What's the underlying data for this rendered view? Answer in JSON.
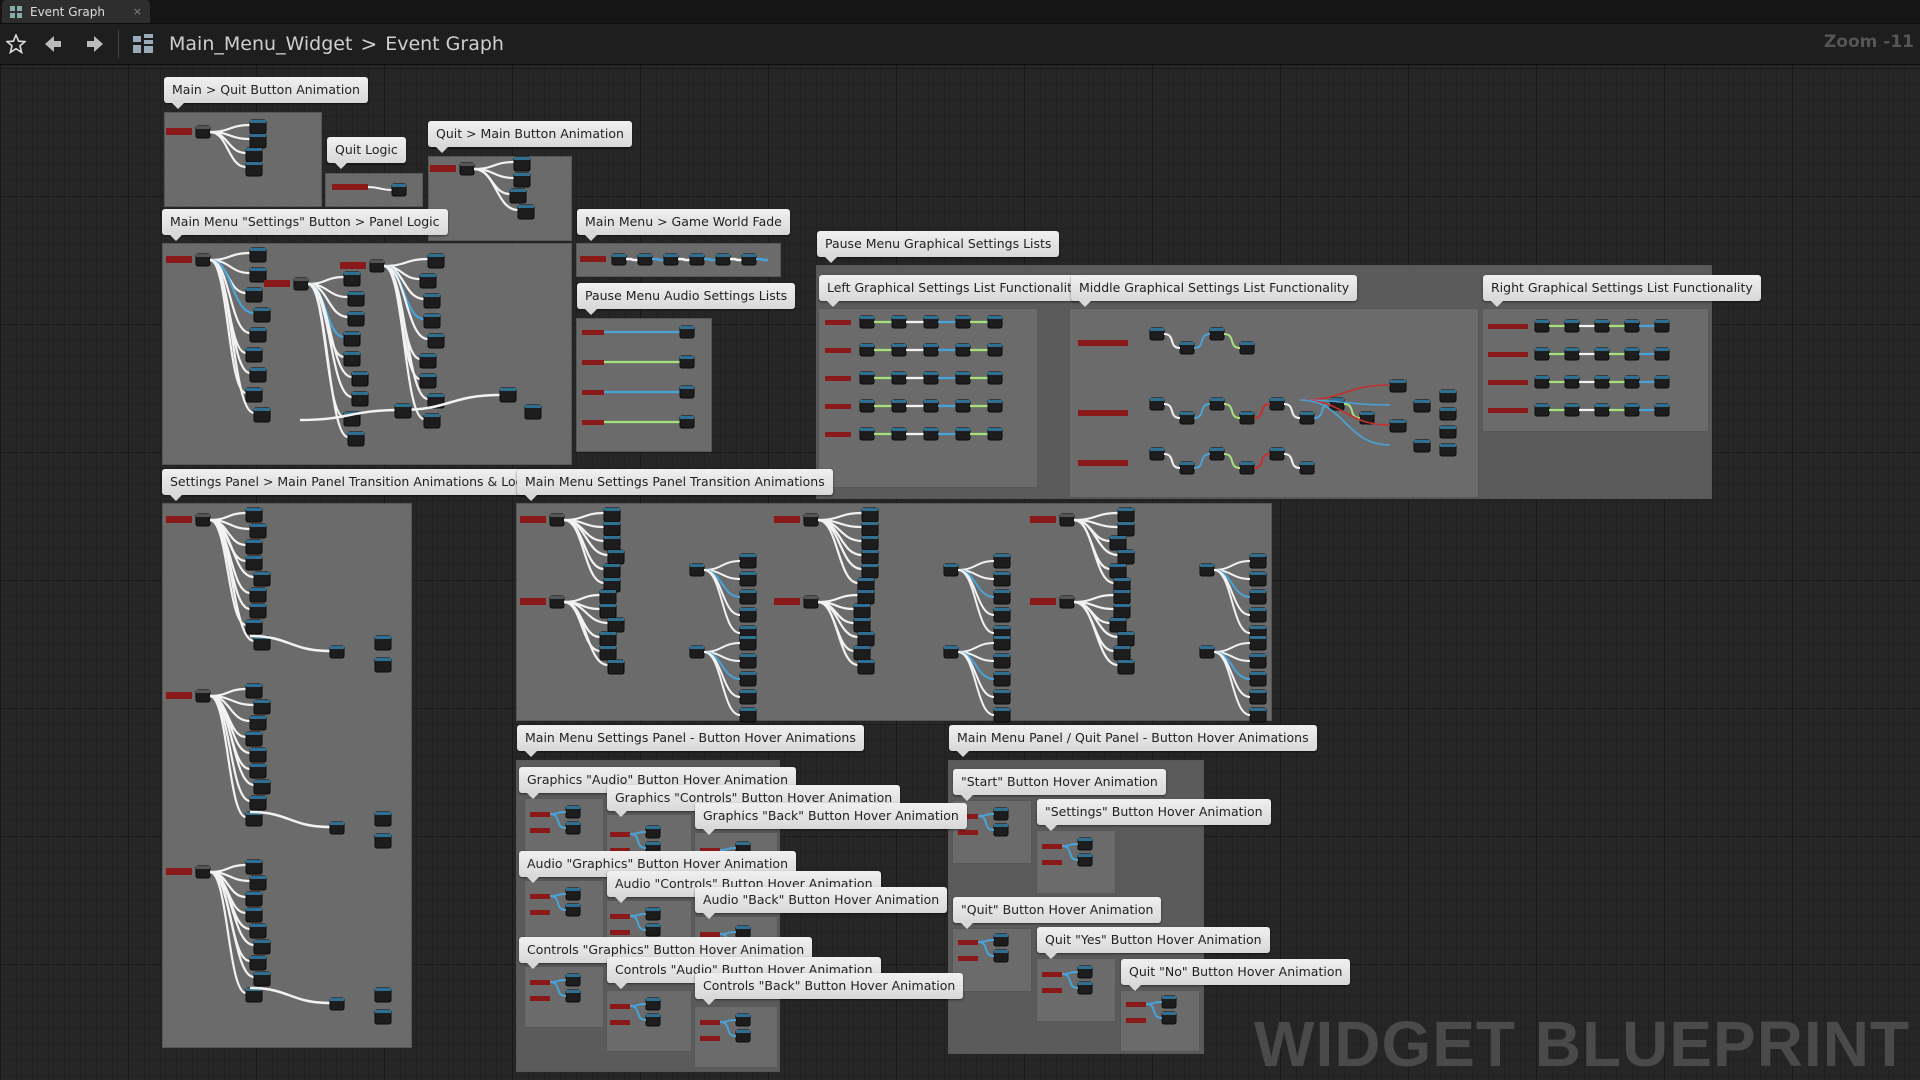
{
  "tab": {
    "title": "Event Graph",
    "close": "×"
  },
  "toolbar": {
    "star_icon": "star-icon",
    "back_icon": "back-arrow-icon",
    "forward_icon": "forward-arrow-icon"
  },
  "breadcrumb": {
    "blueprint": "Main_Menu_Widget",
    "separator": ">",
    "graph": "Event Graph"
  },
  "zoom": "Zoom -11",
  "watermark": "WIDGET BLUEPRINT",
  "comments": {
    "c1": "Main > Quit Button Animation",
    "c2": "Quit Logic",
    "c3": "Quit > Main Button Animation",
    "c4": "Main Menu \"Settings\" Button > Panel Logic",
    "c5": "Main Menu > Game World Fade",
    "c6": "Pause Menu Audio Settings Lists",
    "c7": "Pause Menu Graphical Settings Lists",
    "c8": "Left Graphical Settings List Functionality",
    "c9": "Middle Graphical Settings List Functionality",
    "c10": "Right Graphical Settings List Functionality",
    "c11": "Settings Panel > Main Panel Transition Animations & Logic",
    "c12": "Main Menu Settings Panel Transition Animations",
    "c13": "Main Menu Settings Panel - Button Hover Animations",
    "c14": "Main Menu Panel / Quit Panel - Button Hover Animations",
    "c15": "Graphics \"Audio\" Button Hover Animation",
    "c16": "Graphics \"Controls\" Button Hover Animation",
    "c17": "Graphics \"Back\" Button Hover Animation",
    "c18": "Audio \"Graphics\" Button Hover Animation",
    "c19": "Audio \"Controls\" Button Hover Animation",
    "c20": "Audio \"Back\" Button Hover Animation",
    "c21": "Controls \"Graphics\" Button Hover Animation",
    "c22": "Controls \"Audio\" Button Hover Animation",
    "c23": "Controls \"Back\" Button Hover Animation",
    "c24": "\"Start\" Button Hover Animation",
    "c25": "\"Settings\" Button Hover Animation",
    "c26": "\"Quit\" Button Hover Animation",
    "c27": "Quit \"Yes\" Button Hover Animation",
    "c28": "Quit \"No\" Button Hover Animation"
  }
}
